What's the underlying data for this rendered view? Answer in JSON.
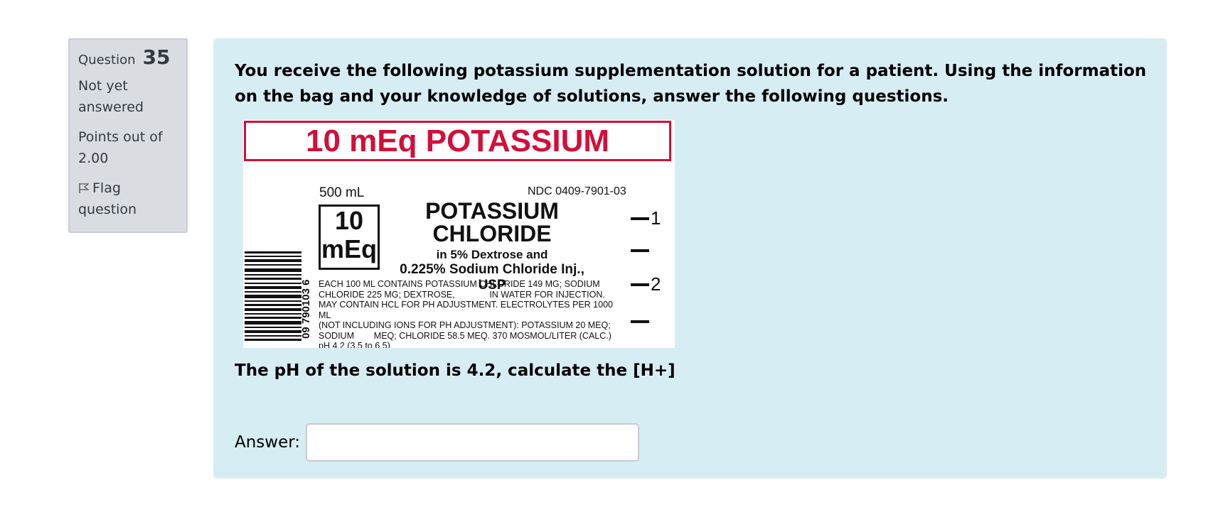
{
  "question_info": {
    "question_label": "Question",
    "question_number": "35",
    "state": "Not yet answered",
    "grade": "Points out of 2.00",
    "flag_label": "Flag question"
  },
  "content": {
    "question_text": "You receive the following potassium supplementation solution for a patient. Using the information on the bag and your knowledge of solutions, answer the following questions.",
    "sub_question": "The pH of the solution is 4.2, calculate the [H+]",
    "answer_label": "Answer:",
    "answer_value": ""
  },
  "bag_label": {
    "banner": "10 mEq POTASSIUM",
    "volume": "500 mL",
    "ndc": "NDC 0409-7901-03",
    "meq_number": "10",
    "meq_unit": "mEq",
    "drug_line1": "POTASSIUM",
    "drug_line2": "CHLORIDE",
    "drug_line3": "in 5% Dextrose and",
    "drug_line4": "0.225% Sodium Chloride Inj., USP",
    "fine_print_1": "EACH 100 mL CONTAINS POTASSIUM CHLORIDE 149 mg; SODIUM",
    "fine_print_2": "CHLORIDE 225 mg; DEXTROSE,              IN WATER FOR INJECTION.",
    "fine_print_3": "MAY CONTAIN HCl FOR pH ADJUSTMENT. ELECTROLYTES PER 1000 mL",
    "fine_print_4": "(NOT INCLUDING IONS FOR pH ADJUSTMENT): POTASSIUM 20 mEq;",
    "fine_print_5": "SODIUM        mEq; CHLORIDE 58.5 mEq. 370 mOsmol/LITER (CALC.)",
    "fine_print_6": "pH 4.2 (3.5 to 6.5)",
    "barcode_number": "09 790103 6",
    "graduation_1": "1",
    "graduation_2": "2"
  },
  "colors": {
    "info_bg": "#d9dde1",
    "content_bg": "#d7edf4",
    "label_red": "#d0103a"
  }
}
